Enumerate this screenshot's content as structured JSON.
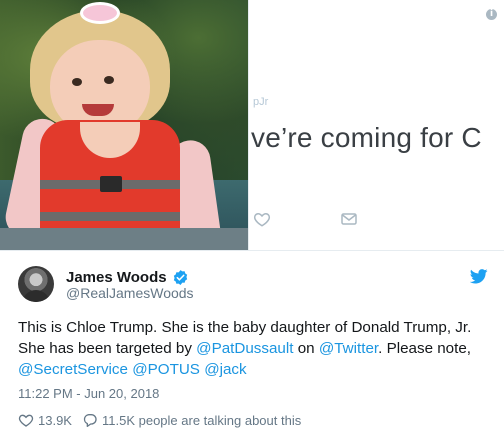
{
  "colors": {
    "link_blue": "#1b95e0",
    "secondary_text": "#657786",
    "primary_text": "#14171a",
    "verified_blue": "#1da1f2"
  },
  "media": {
    "photo_description_icon": "photo",
    "screenshot": {
      "handle_fragment": "pJr",
      "text_fragment": "ve’re coming for C",
      "info_icon": "info-icon",
      "info_glyph": "i"
    }
  },
  "tweet": {
    "display_name": "James Woods",
    "handle": "@RealJamesWoods",
    "text": {
      "part1": "This is Chloe Trump. She is the baby daughter of Donald Trump, Jr. She has been targeted by ",
      "mention1": "@PatDussault",
      "part2": " on ",
      "mention2": "@Twitter",
      "part3": ". Please note, ",
      "mention3": "@SecretService",
      "part4": " ",
      "mention4": "@POTUS",
      "part5": " ",
      "mention5": "@jack"
    },
    "timestamp": "11:22 PM - Jun 20, 2018",
    "likes": "13.9K",
    "replies_summary": "11.5K people are talking about this"
  }
}
